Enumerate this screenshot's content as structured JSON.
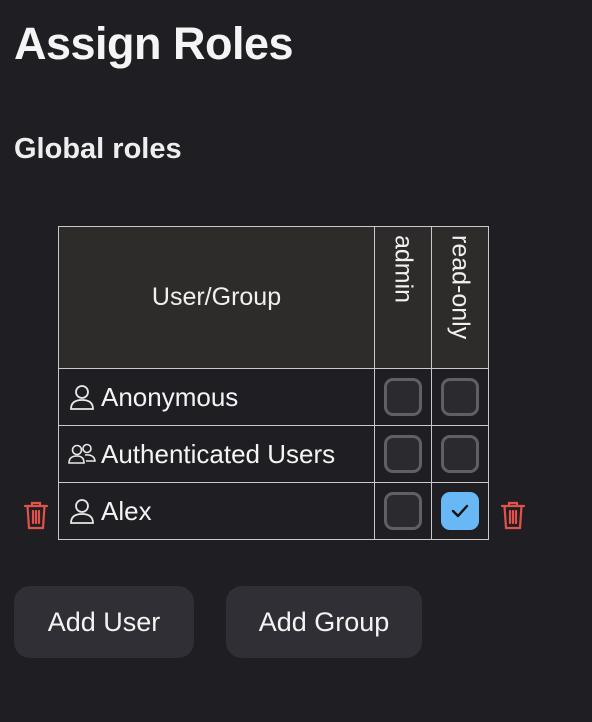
{
  "page": {
    "title": "Assign Roles",
    "section_title": "Global roles"
  },
  "table": {
    "header_user": "User/Group",
    "roles": [
      "admin",
      "read-only"
    ],
    "rows": [
      {
        "icon": "user-icon",
        "name": "Anonymous",
        "admin": false,
        "read_only": false,
        "deletable": false
      },
      {
        "icon": "group-icon",
        "name": "Authenticated Users",
        "admin": false,
        "read_only": false,
        "deletable": false
      },
      {
        "icon": "user-icon",
        "name": "Alex",
        "admin": false,
        "read_only": true,
        "deletable": true
      }
    ]
  },
  "buttons": {
    "add_user": "Add User",
    "add_group": "Add Group"
  },
  "colors": {
    "background": "#1f1e23",
    "checked": "#68b8f5",
    "delete": "#e0524a",
    "button_bg": "#2f2f35"
  }
}
